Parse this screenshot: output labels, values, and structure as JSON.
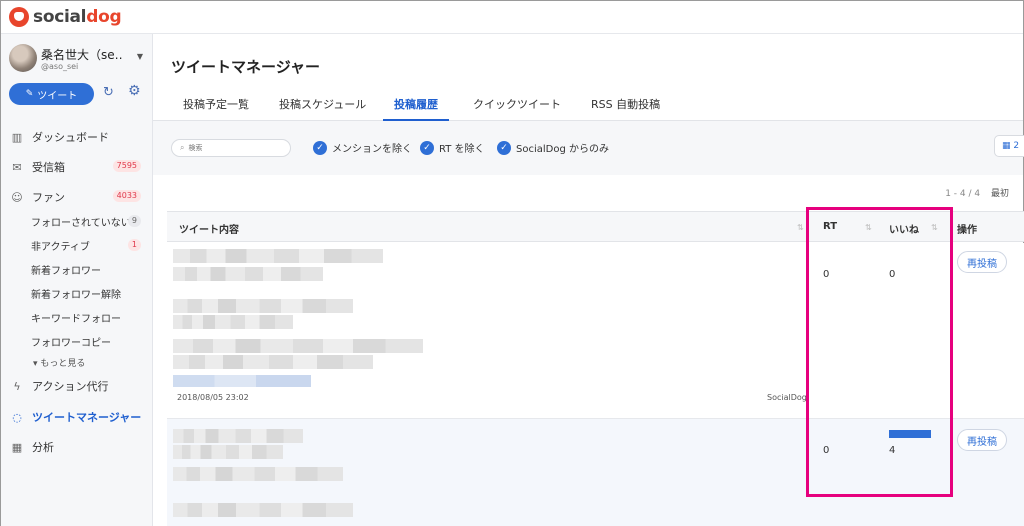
{
  "app": {
    "logo_social": "social",
    "logo_dog": "dog"
  },
  "user": {
    "name": "桑名世大（se…",
    "handle": "@aso_sei"
  },
  "sidebar": {
    "tweet_button": "ツイート",
    "items": [
      {
        "label": "ダッシュボード",
        "icon": "chart-icon"
      },
      {
        "label": "受信箱",
        "icon": "inbox-icon",
        "badge": "7595"
      },
      {
        "label": "ファン",
        "icon": "users-icon",
        "badge": "4033"
      }
    ],
    "fan_sub": [
      {
        "label": "フォローされていない",
        "badge": "9"
      },
      {
        "label": "非アクティブ",
        "badge": "1"
      },
      {
        "label": "新着フォロワー"
      },
      {
        "label": "新着フォロワー解除"
      },
      {
        "label": "キーワードフォロー"
      },
      {
        "label": "フォロワーコピー"
      }
    ],
    "more": "もっと見る",
    "items2": [
      {
        "label": "アクション代行",
        "icon": "bolt-icon"
      },
      {
        "label": "ツイートマネージャー",
        "icon": "chat-icon"
      },
      {
        "label": "分析",
        "icon": "analytics-icon"
      }
    ]
  },
  "main": {
    "title": "ツイートマネージャー",
    "tabs": [
      "投稿予定一覧",
      "投稿スケジュール",
      "投稿履歴",
      "クイックツイート",
      "RSS 自動投稿"
    ],
    "active_tab": 2,
    "search_placeholder": "検索",
    "filters": [
      "メンションを除く",
      "RT を除く",
      "SocialDog からのみ"
    ],
    "calendar_label": "2",
    "pager": {
      "range": "1 - 4 / 4",
      "label": "最初"
    },
    "table": {
      "headers": {
        "content": "ツイート内容",
        "rt": "RT",
        "likes": "いいね",
        "action": "操作"
      },
      "rows": [
        {
          "date": "2018/08/05 23:02",
          "source": "SocialDog",
          "rt": "0",
          "likes": "0",
          "likes_bar": 0,
          "action": "再投稿"
        },
        {
          "date": "",
          "source": "",
          "rt": "0",
          "likes": "4",
          "likes_bar": 1,
          "action": "再投稿"
        }
      ]
    }
  },
  "colors": {
    "accent": "#2f6fd6",
    "brand": "#e8452c",
    "highlight": "#e6007e",
    "badge_red": "#e0394b"
  }
}
